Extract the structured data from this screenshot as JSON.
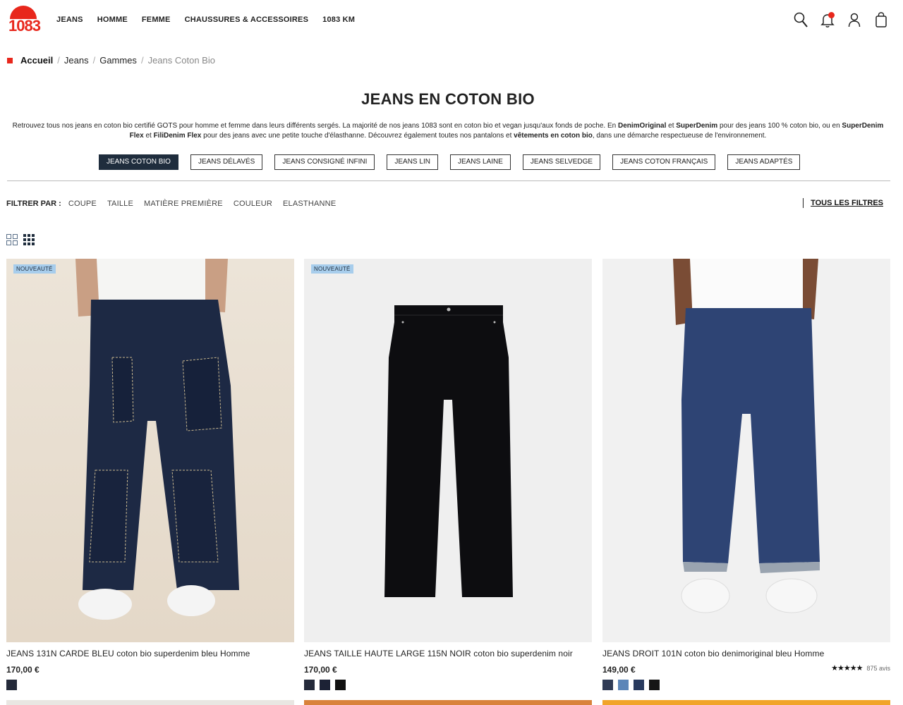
{
  "brand": {
    "logo_text": "1083"
  },
  "nav": {
    "items": [
      "JEANS",
      "HOMME",
      "FEMME",
      "CHAUSSURES & ACCESSOIRES",
      "1083 KM"
    ]
  },
  "header_icons": [
    "search-icon",
    "bell-icon",
    "user-icon",
    "cart-icon"
  ],
  "breadcrumb": {
    "home": "Accueil",
    "items": [
      "Jeans",
      "Gammes"
    ],
    "current": "Jeans Coton Bio"
  },
  "page": {
    "title": "JEANS EN COTON BIO",
    "desc_1": "Retrouvez tous nos jeans en coton bio certifié GOTS pour homme et femme dans leurs différents sergés. La majorité de nos jeans 1083 sont en coton bio et vegan jusqu'aux fonds de poche. En ",
    "desc_b1": "DenimOriginal",
    "desc_2": " et ",
    "desc_b2": "SuperDenim",
    "desc_3": " pour des jeans 100 % coton bio, ou en ",
    "desc_b3": "SuperDenim Flex",
    "desc_4": " et ",
    "desc_b4": "FiliDenim Flex",
    "desc_5": " pour des jeans avec une petite touche d'élasthanne. Découvrez également toutes nos pantalons et ",
    "desc_b5": "vêtements en coton bio",
    "desc_6": ", dans une démarche respectueuse de l'environnement."
  },
  "categories": [
    "JEANS COTON BIO",
    "JEANS DÉLAVÉS",
    "JEANS CONSIGNÉ INFINI",
    "JEANS LIN",
    "JEANS LAINE",
    "JEANS SELVEDGE",
    "JEANS COTON FRANÇAIS",
    "JEANS ADAPTÉS"
  ],
  "active_category": "JEANS COTON BIO",
  "filters": {
    "label": "FILTRER PAR :",
    "items": [
      "COUPE",
      "TAILLE",
      "MATIÈRE PREMIÈRE",
      "COULEUR",
      "ELASTHANNE"
    ],
    "all_label": "TOUS LES FILTRES"
  },
  "products": [
    {
      "name": "JEANS 131N CARDE BLEU coton bio superdenim bleu Homme",
      "price": "170,00 €",
      "badge": "NOUVEAUTÉ",
      "swatches": [
        "#242a3a"
      ]
    },
    {
      "name": "JEANS TAILLE HAUTE LARGE 115N NOIR coton bio superdenim noir",
      "price": "170,00 €",
      "badge": "NOUVEAUTÉ",
      "swatches": [
        "#242a3a",
        "#1c2235",
        "#111111"
      ]
    },
    {
      "name": "JEANS DROIT 101N coton bio denimoriginal bleu Homme",
      "price": "149,00 €",
      "badge": "",
      "swatches": [
        "#2f3b55",
        "#5d86b8",
        "#283a5e",
        "#151515"
      ],
      "rating_text": "875 avis",
      "stars": "★★★★★"
    }
  ],
  "colors": {
    "accent": "#e8271c",
    "navy": "#1f2d3d",
    "badge": "#a7cdec"
  }
}
